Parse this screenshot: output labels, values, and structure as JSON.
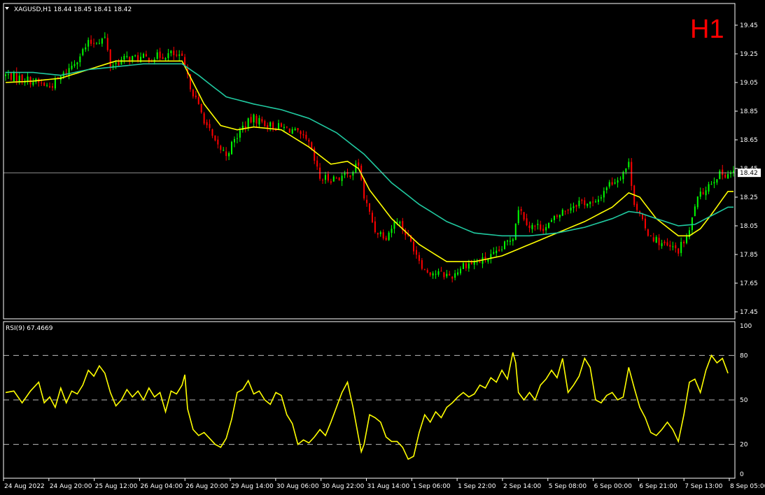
{
  "header": {
    "symbol_line": "XAGUSD,H1  18.44 18.45 18.41 18.42",
    "timeframe_badge": "H1"
  },
  "colors": {
    "background": "#000000",
    "bull": "#00ff00",
    "bear": "#ff0000",
    "ma_fast": "#ffff00",
    "ma_slow": "#20c9a0",
    "rsi": "#ffff00",
    "grid": "#ffffff",
    "price_line": "#c0c0c0",
    "badge": "#ff0000"
  },
  "current_price_label": "18.42",
  "rsi_label": "RSI(9) 67.4669",
  "chart_data": [
    {
      "type": "candlestick",
      "title": "XAGUSD,H1",
      "ylim": [
        17.4,
        19.55
      ],
      "y_ticks": [
        "19.45",
        "19.25",
        "19.05",
        "18.85",
        "18.65",
        "18.45",
        "18.25",
        "18.05",
        "17.85",
        "17.65",
        "17.45"
      ],
      "x_ticks": [
        "24 Aug 2022",
        "24 Aug 20:00",
        "25 Aug 12:00",
        "26 Aug 04:00",
        "26 Aug 20:00",
        "29 Aug 14:00",
        "30 Aug 06:00",
        "30 Aug 22:00",
        "31 Aug 14:00",
        "1 Sep 06:00",
        "1 Sep 22:00",
        "2 Sep 14:00",
        "5 Sep 08:00",
        "6 Sep 00:00",
        "6 Sep 21:00",
        "7 Sep 13:00",
        "8 Sep 05:00"
      ],
      "last_price": 18.42,
      "close_path": [
        [
          0,
          19.1
        ],
        [
          6,
          19.08
        ],
        [
          10,
          19.06
        ],
        [
          16,
          19.02
        ],
        [
          22,
          19.12
        ],
        [
          30,
          19.32
        ],
        [
          36,
          19.36
        ],
        [
          38,
          19.17
        ],
        [
          44,
          19.22
        ],
        [
          52,
          19.22
        ],
        [
          60,
          19.25
        ],
        [
          64,
          19.21
        ],
        [
          66,
          19.08
        ],
        [
          70,
          18.88
        ],
        [
          76,
          18.62
        ],
        [
          80,
          18.55
        ],
        [
          86,
          18.74
        ],
        [
          90,
          18.8
        ],
        [
          96,
          18.75
        ],
        [
          104,
          18.72
        ],
        [
          110,
          18.62
        ],
        [
          114,
          18.38
        ],
        [
          118,
          18.38
        ],
        [
          124,
          18.4
        ],
        [
          128,
          18.48
        ],
        [
          130,
          18.25
        ],
        [
          134,
          18.02
        ],
        [
          138,
          17.98
        ],
        [
          142,
          18.1
        ],
        [
          148,
          17.9
        ],
        [
          152,
          17.74
        ],
        [
          156,
          17.72
        ],
        [
          162,
          17.7
        ],
        [
          166,
          17.78
        ],
        [
          172,
          17.8
        ],
        [
          178,
          17.85
        ],
        [
          184,
          17.98
        ],
        [
          186,
          18.18
        ],
        [
          190,
          18.05
        ],
        [
          196,
          18.04
        ],
        [
          202,
          18.15
        ],
        [
          208,
          18.22
        ],
        [
          214,
          18.2
        ],
        [
          218,
          18.33
        ],
        [
          222,
          18.38
        ],
        [
          226,
          18.48
        ],
        [
          228,
          18.22
        ],
        [
          232,
          18.02
        ],
        [
          236,
          17.95
        ],
        [
          240,
          17.9
        ],
        [
          244,
          17.88
        ],
        [
          248,
          18.0
        ],
        [
          250,
          18.2
        ],
        [
          254,
          18.32
        ],
        [
          258,
          18.4
        ],
        [
          262,
          18.42
        ]
      ],
      "series": [
        {
          "name": "",
          "style": "line",
          "x": [
            0,
            10,
            20,
            30,
            40,
            50,
            60,
            64,
            68,
            72,
            78,
            84,
            90,
            100,
            110,
            118,
            124,
            128,
            132,
            140,
            150,
            160,
            170,
            180,
            190,
            200,
            210,
            220,
            226,
            230,
            236,
            244,
            248,
            252,
            256,
            262
          ],
          "values": [
            19.05,
            19.06,
            19.08,
            19.14,
            19.2,
            19.2,
            19.2,
            19.2,
            19.05,
            18.9,
            18.75,
            18.72,
            18.74,
            18.72,
            18.6,
            18.48,
            18.5,
            18.45,
            18.3,
            18.1,
            17.92,
            17.8,
            17.8,
            17.84,
            17.92,
            18.0,
            18.08,
            18.18,
            18.28,
            18.25,
            18.1,
            17.98,
            17.98,
            18.03,
            18.13,
            18.29
          ]
        },
        {
          "name": "",
          "style": "line",
          "x": [
            0,
            10,
            20,
            30,
            40,
            50,
            60,
            64,
            70,
            80,
            90,
            100,
            110,
            120,
            130,
            140,
            150,
            160,
            170,
            180,
            190,
            200,
            210,
            220,
            226,
            230,
            236,
            244,
            250,
            256,
            262
          ],
          "values": [
            19.12,
            19.12,
            19.1,
            19.14,
            19.16,
            19.18,
            19.18,
            19.18,
            19.1,
            18.95,
            18.9,
            18.86,
            18.8,
            18.7,
            18.55,
            18.35,
            18.2,
            18.08,
            18.0,
            17.98,
            17.98,
            18.0,
            18.04,
            18.1,
            18.15,
            18.14,
            18.1,
            18.05,
            18.06,
            18.12,
            18.18
          ]
        }
      ]
    },
    {
      "type": "line",
      "title": "RSI(9) 67.4669",
      "ylim": [
        0,
        100
      ],
      "y_ticks": [
        "100",
        "80",
        "50",
        "20",
        "0"
      ],
      "levels": [
        80,
        50,
        20
      ],
      "series": [
        {
          "name": "RSI(9)",
          "x": [
            0,
            3,
            6,
            9,
            12,
            14,
            16,
            18,
            20,
            22,
            24,
            26,
            28,
            30,
            32,
            34,
            36,
            38,
            40,
            42,
            44,
            46,
            48,
            50,
            52,
            54,
            56,
            58,
            60,
            62,
            64,
            65,
            66,
            68,
            70,
            72,
            74,
            76,
            78,
            80,
            82,
            84,
            86,
            88,
            90,
            92,
            94,
            96,
            98,
            100,
            102,
            104,
            106,
            108,
            110,
            112,
            114,
            116,
            118,
            120,
            122,
            124,
            126,
            128,
            129,
            130,
            132,
            134,
            136,
            138,
            140,
            142,
            144,
            146,
            148,
            150,
            152,
            154,
            156,
            158,
            160,
            162,
            164,
            166,
            168,
            170,
            172,
            174,
            176,
            178,
            180,
            182,
            184,
            185,
            186,
            188,
            190,
            192,
            194,
            196,
            198,
            200,
            202,
            204,
            206,
            208,
            210,
            212,
            214,
            216,
            218,
            220,
            222,
            224,
            226,
            228,
            230,
            232,
            234,
            236,
            238,
            240,
            242,
            244,
            246,
            248,
            250,
            252,
            254,
            256,
            258,
            260,
            262
          ],
          "values": [
            55,
            56,
            48,
            56,
            62,
            48,
            52,
            45,
            58,
            48,
            56,
            54,
            60,
            70,
            66,
            73,
            68,
            55,
            46,
            50,
            57,
            52,
            56,
            50,
            58,
            52,
            55,
            42,
            56,
            54,
            60,
            67,
            44,
            30,
            26,
            28,
            24,
            20,
            18,
            24,
            37,
            55,
            57,
            63,
            54,
            56,
            50,
            47,
            55,
            53,
            40,
            34,
            20,
            23,
            21,
            25,
            30,
            26,
            35,
            45,
            55,
            62,
            45,
            25,
            15,
            20,
            40,
            38,
            35,
            25,
            22,
            22,
            18,
            10,
            12,
            28,
            40,
            35,
            42,
            38,
            45,
            48,
            52,
            55,
            52,
            54,
            60,
            58,
            65,
            62,
            70,
            64,
            82,
            75,
            55,
            50,
            55,
            50,
            60,
            64,
            70,
            65,
            78,
            55,
            60,
            66,
            78,
            72,
            50,
            48,
            53,
            55,
            50,
            52,
            72,
            58,
            45,
            38,
            28,
            26,
            30,
            35,
            30,
            22,
            40,
            62,
            64,
            55,
            70,
            80,
            75,
            78,
            68
          ]
        }
      ]
    }
  ]
}
